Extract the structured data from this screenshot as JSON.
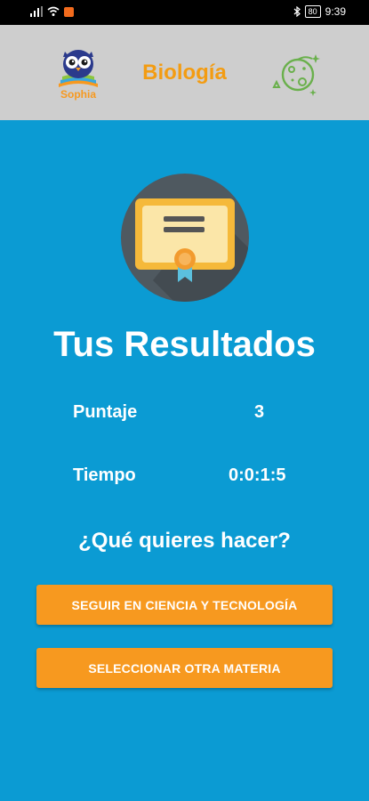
{
  "status_bar": {
    "time": "9:39",
    "battery": "80",
    "signal_icon": "signal-bars-icon",
    "wifi_icon": "wifi-icon",
    "notification_icon": "app-notification-icon",
    "bluetooth_icon": "bluetooth-icon"
  },
  "app_bar": {
    "logo_text": "Sophia",
    "title": "Biología",
    "subject_icon": "microbe-icon"
  },
  "results": {
    "title": "Tus Resultados",
    "score_label": "Puntaje",
    "score_value": "3",
    "time_label": "Tiempo",
    "time_value": "0:0:1:5"
  },
  "actions": {
    "question": "¿Qué quieres hacer?",
    "continue_button": "SEGUIR EN CIENCIA Y TECNOLOGÍA",
    "select_button": "SELECCIONAR OTRA MATERIA"
  },
  "colors": {
    "background": "#0b9bd3",
    "appbar": "#cecece",
    "accent_orange": "#f7991f",
    "title_orange": "#f39c12",
    "icon_green": "#6ab04c",
    "circle_gray": "#4f5960"
  }
}
